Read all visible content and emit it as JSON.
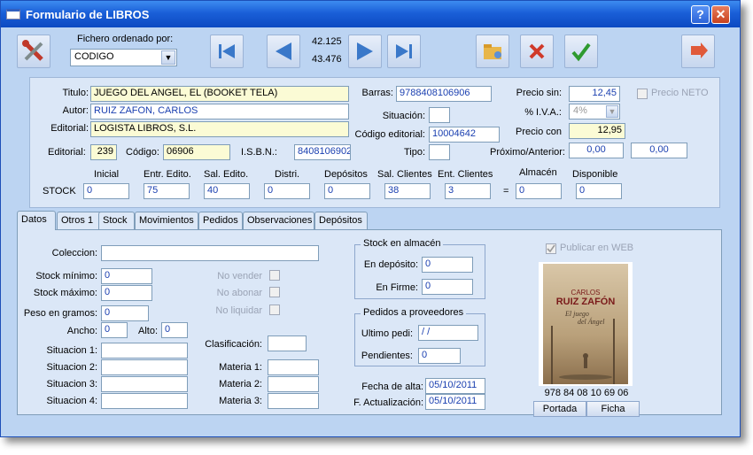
{
  "window": {
    "title": "Formulario de LIBROS"
  },
  "toolbar": {
    "sort_label": "Fichero ordenado por:",
    "sort_value": "CODIGO",
    "record_current": "42.125",
    "record_total": "43.476"
  },
  "book": {
    "titulo_label": "Titulo:",
    "titulo": "JUEGO DEL ANGEL, EL (BOOKET TELA)",
    "autor_label": "Autor:",
    "autor": "RUIZ ZAFON, CARLOS",
    "editorial_label": "Editorial:",
    "editorial": "LOGISTA LIBROS, S.L.",
    "editorial_num_label": "Editorial:",
    "editorial_num": "239",
    "codigo_label": "Código:",
    "codigo": "06906",
    "isbn_label": "I.S.B.N.:",
    "isbn": "8408106902",
    "barras_label": "Barras:",
    "barras": "9788408106906",
    "situacion_label": "Situación:",
    "situacion": "",
    "codigo_editorial_label": "Código editorial:",
    "codigo_editorial": "10004642",
    "tipo_label": "Tipo:",
    "tipo": "",
    "precio_sin_label": "Precio sin:",
    "precio_sin": "12,45",
    "iva_label": "% I.V.A.:",
    "iva": "4%",
    "precio_con_label": "Precio con",
    "precio_con": "12,95",
    "prox_ant_label": "Próximo/Anterior:",
    "proximo": "0,00",
    "anterior": "0,00",
    "precio_neto_label": "Precio NETO"
  },
  "stock": {
    "row_label": "STOCK",
    "headers": [
      "Inicial",
      "Entr. Edito.",
      "Sal. Edito.",
      "Distri.",
      "Depósitos",
      "Sal. Clientes",
      "Ent. Clientes",
      "Almacén",
      "Disponible"
    ],
    "values": [
      "0",
      "75",
      "40",
      "0",
      "0",
      "38",
      "3",
      "0",
      "0"
    ],
    "equals": "="
  },
  "tabs": [
    "Datos",
    "Otros 1",
    "Stock",
    "Movimientos",
    "Pedidos",
    "Observaciones",
    "Depósitos"
  ],
  "datos": {
    "coleccion_label": "Coleccion:",
    "coleccion": "",
    "stock_min_label": "Stock mínimo:",
    "stock_min": "0",
    "stock_max_label": "Stock máximo:",
    "stock_max": "0",
    "peso_label": "Peso en gramos:",
    "peso": "0",
    "ancho_label": "Ancho:",
    "ancho": "0",
    "alto_label": "Alto:",
    "alto": "0",
    "no_vender": "No vender",
    "no_abonar": "No abonar",
    "no_liquidar": "No liquidar",
    "situacion1_label": "Situacion 1:",
    "situacion2_label": "Situacion 2:",
    "situacion3_label": "Situacion 3:",
    "situacion4_label": "Situacion 4:",
    "clasificacion_label": "Clasificación:",
    "materia1_label": "Materia 1:",
    "materia2_label": "Materia 2:",
    "materia3_label": "Materia 3:",
    "stock_almacen_title": "Stock en almacén",
    "en_deposito_label": "En depósito:",
    "en_deposito": "0",
    "en_firme_label": "En Firme:",
    "en_firme": "0",
    "pedidos_title": "Pedidos a proveedores",
    "ultimo_pedi_label": "Ultimo pedi:",
    "ultimo_pedi": "/ /",
    "pendientes_label": "Pendientes:",
    "pendientes": "0",
    "fecha_alta_label": "Fecha de alta:",
    "fecha_alta": "05/10/2011",
    "f_actualizacion_label": "F. Actualización:",
    "f_actualizacion": "05/10/2011",
    "publicar_web": "Publicar en WEB"
  },
  "cover": {
    "author_line1": "CARLOS",
    "author_line2": "RUIZ ZAFÓN",
    "title_line1": "El juego",
    "title_line2": "del Ángel",
    "barcode_text": "978 84 08 10 69 06",
    "portada_button": "Portada",
    "ficha_button": "Ficha"
  }
}
